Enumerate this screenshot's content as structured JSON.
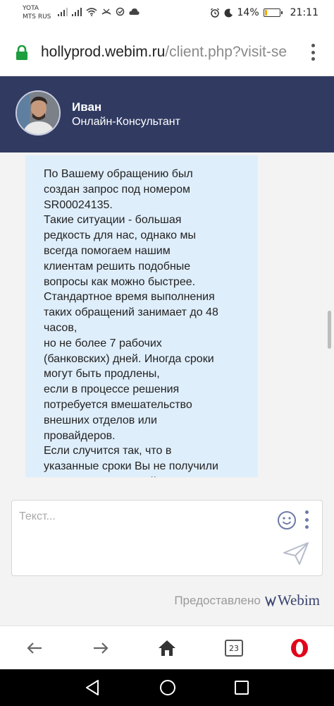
{
  "status_bar": {
    "carrier_1": "YOTA",
    "carrier_2": "MTS RUS",
    "battery": "14%",
    "battery_level": 0.14,
    "time": "21:11"
  },
  "browser": {
    "url_host": "hollyprod.webim.ru",
    "url_path": "/client.php?visit-se",
    "tab_count": "23"
  },
  "operator": {
    "name": "Иван",
    "role": "Онлайн-Консультант"
  },
  "messages": [
    {
      "text": "По Вашему обращению был\nсоздан запрос под номером\nSR00024135.\nТакие ситуации - большая\nредкость для нас, однако мы\nвсегда помогаем нашим\nклиентам решить подобные\nвопросы как можно быстрее.\nСтандартное время выполнения\nтаких обращений занимает до 48\nчасов,\nно не более 7 рабочих\n(банковских) дней. Иногда сроки\nмогут быть продлены,\nесли в процессе решения\nпотребуется вмешательство\nвнешних отделов или\nпровайдеров.\nЕсли случится так, что в\nуказанные сроки Вы не получили\nответ по электронной почте"
    }
  ],
  "composer": {
    "placeholder": "Текст..."
  },
  "powered_by": {
    "label": "Предоставлено",
    "brand": "Webim"
  },
  "colors": {
    "header_bg": "#313b62",
    "bubble_bg": "#dfeefb",
    "lock_green": "#1e9e3e",
    "opera_red": "#e0061b"
  }
}
